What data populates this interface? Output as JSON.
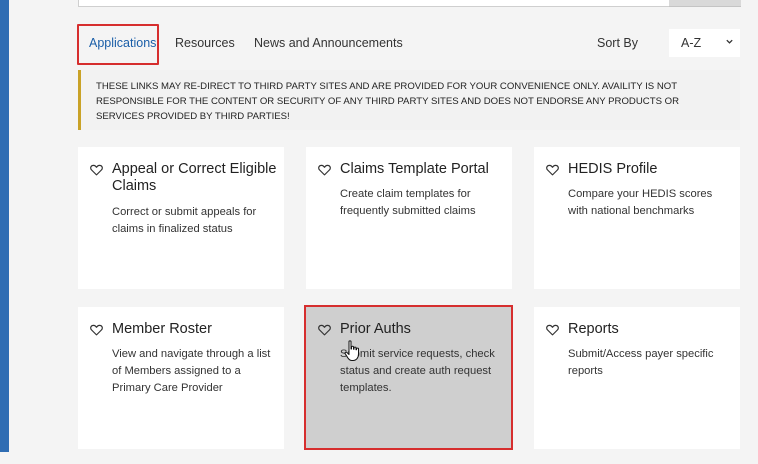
{
  "tabs": [
    {
      "label": "Applications",
      "active": true
    },
    {
      "label": "Resources",
      "active": false
    },
    {
      "label": "News and Announcements",
      "active": false
    }
  ],
  "sort": {
    "label": "Sort By",
    "selected": "A-Z"
  },
  "disclaimer": "THESE LINKS MAY RE-DIRECT TO THIRD PARTY SITES AND ARE PROVIDED FOR YOUR CONVENIENCE ONLY. AVAILITY IS NOT RESPONSIBLE FOR THE CONTENT OR SECURITY OF ANY THIRD PARTY SITES AND DOES NOT ENDORSE ANY PRODUCTS OR SERVICES PROVIDED BY THIRD PARTIES!",
  "cards": [
    {
      "title": "Appeal or Correct Eligible Claims",
      "description": "Correct or submit appeals for claims in finalized status"
    },
    {
      "title": "Claims Template Portal",
      "description": "Create claim templates for frequently submitted claims"
    },
    {
      "title": "HEDIS Profile",
      "description": "Compare your HEDIS scores with national benchmarks"
    },
    {
      "title": "Member Roster",
      "description": "View and navigate through a list of Members assigned to a Primary Care Provider"
    },
    {
      "title": "Prior Auths",
      "description": "Submit service requests, check status and create auth request templates."
    },
    {
      "title": "Reports",
      "description": "Submit/Access payer specific reports"
    }
  ],
  "colors": {
    "accent_blue": "#1a5ea8",
    "left_bar": "#2f6db3",
    "highlight_red": "#d62e2e",
    "disclaimer_border": "#c9a227",
    "hovered_card": "#cfcfcf"
  },
  "icons": {
    "favorite": "heart-outline-icon",
    "sort_dropdown": "chevron-down-icon",
    "pointer": "hand-pointer-icon"
  }
}
